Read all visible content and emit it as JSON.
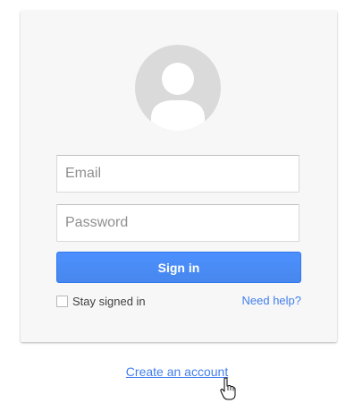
{
  "login": {
    "email_placeholder": "Email",
    "password_placeholder": "Password",
    "signin_label": "Sign in",
    "stay_signed_in_label": "Stay signed in",
    "need_help_label": "Need help?"
  },
  "footer": {
    "create_account_label": "Create an account"
  },
  "icons": {
    "avatar": "person-silhouette-icon",
    "cursor": "hand-pointer-icon"
  },
  "colors": {
    "primary_button": "#4d90fe",
    "link": "#427fed",
    "card_background": "#f7f7f7"
  }
}
